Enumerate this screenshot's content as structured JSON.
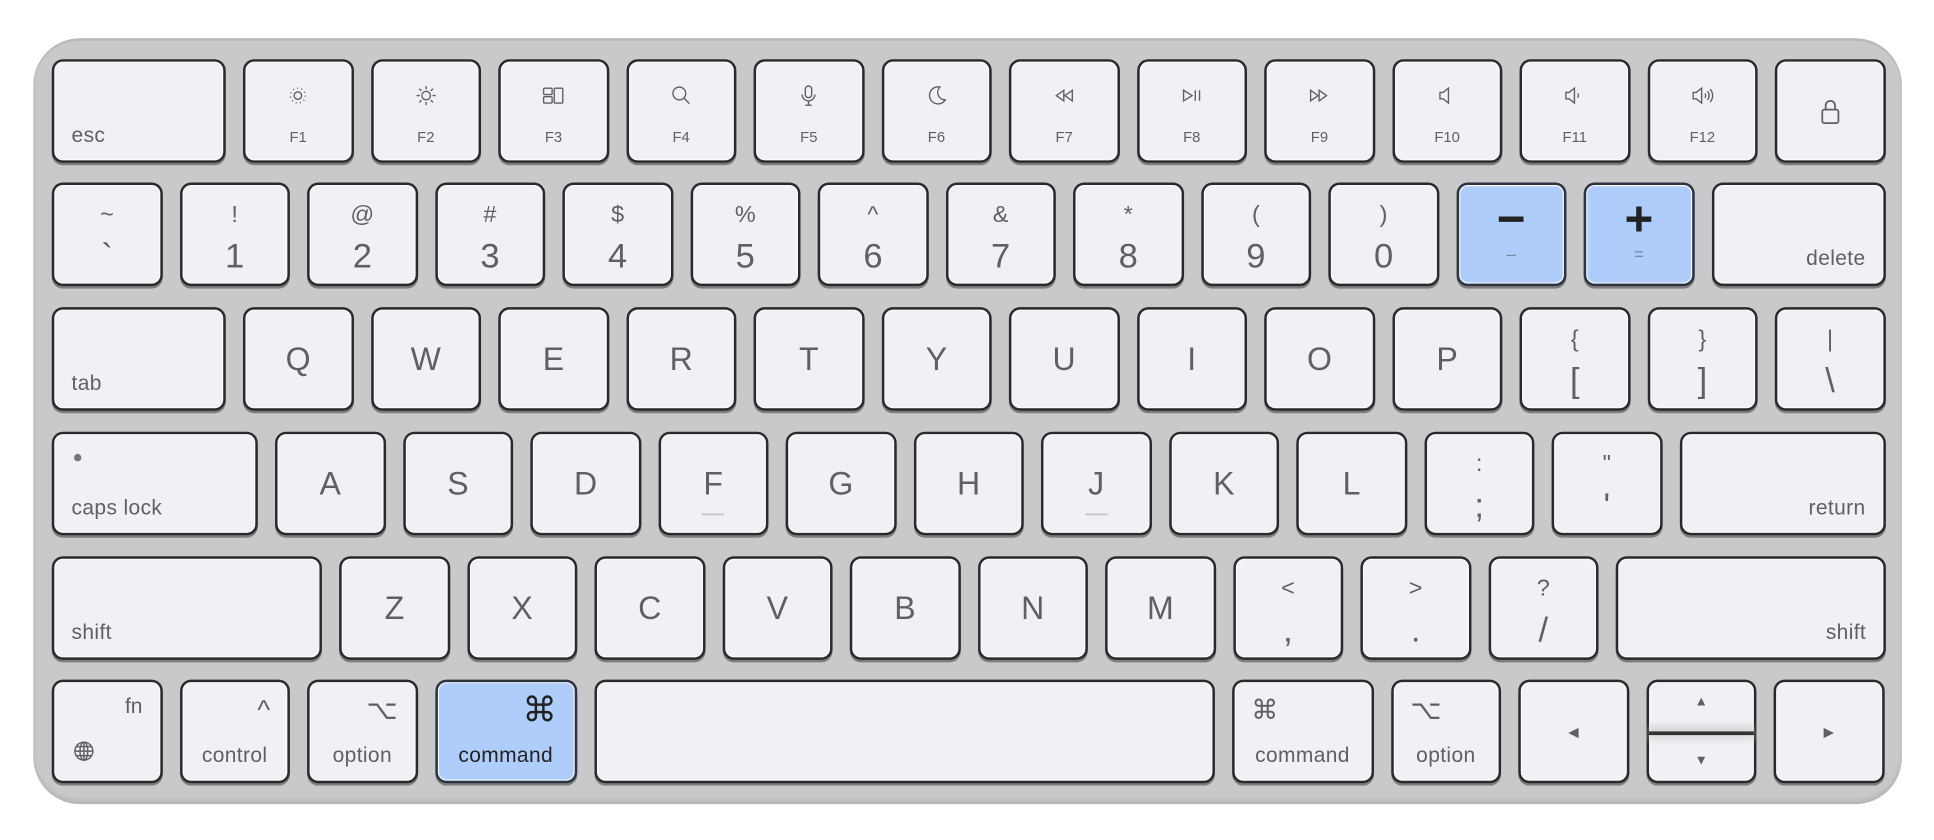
{
  "accent_color": "#aecdfa",
  "rows": [
    [
      {
        "type": "mod",
        "label": "esc",
        "align": "left"
      },
      {
        "type": "fkey",
        "label": "F1",
        "icon": "brightness-down-icon"
      },
      {
        "type": "fkey",
        "label": "F2",
        "icon": "brightness-up-icon"
      },
      {
        "type": "fkey",
        "label": "F3",
        "icon": "mission-control-icon"
      },
      {
        "type": "fkey",
        "label": "F4",
        "icon": "search-icon"
      },
      {
        "type": "fkey",
        "label": "F5",
        "icon": "microphone-icon"
      },
      {
        "type": "fkey",
        "label": "F6",
        "icon": "moon-icon"
      },
      {
        "type": "fkey",
        "label": "F7",
        "icon": "rewind-icon"
      },
      {
        "type": "fkey",
        "label": "F8",
        "icon": "play-pause-icon"
      },
      {
        "type": "fkey",
        "label": "F9",
        "icon": "fast-forward-icon"
      },
      {
        "type": "fkey",
        "label": "F10",
        "icon": "volume-mute-icon"
      },
      {
        "type": "fkey",
        "label": "F11",
        "icon": "volume-down-icon"
      },
      {
        "type": "fkey",
        "label": "F12",
        "icon": "volume-up-icon"
      },
      {
        "type": "iconkey",
        "icon": "lock-icon"
      }
    ],
    [
      {
        "type": "dual",
        "top": "~",
        "bottom": "`"
      },
      {
        "type": "dual",
        "top": "!",
        "bottom": "1"
      },
      {
        "type": "dual",
        "top": "@",
        "bottom": "2"
      },
      {
        "type": "dual",
        "top": "#",
        "bottom": "3"
      },
      {
        "type": "dual",
        "top": "$",
        "bottom": "4"
      },
      {
        "type": "dual",
        "top": "%",
        "bottom": "5"
      },
      {
        "type": "dual",
        "top": "^",
        "bottom": "6"
      },
      {
        "type": "dual",
        "top": "&",
        "bottom": "7"
      },
      {
        "type": "dual",
        "top": "*",
        "bottom": "8"
      },
      {
        "type": "dual",
        "top": "(",
        "bottom": "9"
      },
      {
        "type": "dual",
        "top": ")",
        "bottom": "0"
      },
      {
        "type": "hlsym",
        "top": "−",
        "bottom": "–",
        "highlighted": true
      },
      {
        "type": "hlsym",
        "top": "+",
        "bottom": "=",
        "highlighted": true
      },
      {
        "type": "mod",
        "label": "delete",
        "align": "right"
      }
    ],
    [
      {
        "type": "mod",
        "label": "tab",
        "align": "left"
      },
      {
        "type": "letter",
        "label": "Q"
      },
      {
        "type": "letter",
        "label": "W"
      },
      {
        "type": "letter",
        "label": "E"
      },
      {
        "type": "letter",
        "label": "R"
      },
      {
        "type": "letter",
        "label": "T"
      },
      {
        "type": "letter",
        "label": "Y"
      },
      {
        "type": "letter",
        "label": "U"
      },
      {
        "type": "letter",
        "label": "I"
      },
      {
        "type": "letter",
        "label": "O"
      },
      {
        "type": "letter",
        "label": "P"
      },
      {
        "type": "dual",
        "top": "{",
        "bottom": "["
      },
      {
        "type": "dual",
        "top": "}",
        "bottom": "]"
      },
      {
        "type": "dual",
        "top": "|",
        "bottom": "\\"
      }
    ],
    [
      {
        "type": "mod",
        "label": "caps lock",
        "align": "left",
        "indicator": true
      },
      {
        "type": "letter",
        "label": "A"
      },
      {
        "type": "letter",
        "label": "S"
      },
      {
        "type": "letter",
        "label": "D"
      },
      {
        "type": "letter",
        "label": "F",
        "bump": true
      },
      {
        "type": "letter",
        "label": "G"
      },
      {
        "type": "letter",
        "label": "H"
      },
      {
        "type": "letter",
        "label": "J",
        "bump": true
      },
      {
        "type": "letter",
        "label": "K"
      },
      {
        "type": "letter",
        "label": "L"
      },
      {
        "type": "dual",
        "top": ":",
        "bottom": ";"
      },
      {
        "type": "dual",
        "top": "\"",
        "bottom": "'"
      },
      {
        "type": "mod",
        "label": "return",
        "align": "right"
      }
    ],
    [
      {
        "type": "mod",
        "label": "shift",
        "align": "left"
      },
      {
        "type": "letter",
        "label": "Z"
      },
      {
        "type": "letter",
        "label": "X"
      },
      {
        "type": "letter",
        "label": "C"
      },
      {
        "type": "letter",
        "label": "V"
      },
      {
        "type": "letter",
        "label": "B"
      },
      {
        "type": "letter",
        "label": "N"
      },
      {
        "type": "letter",
        "label": "M"
      },
      {
        "type": "dual",
        "top": "<",
        "bottom": ","
      },
      {
        "type": "dual",
        "top": ">",
        "bottom": "."
      },
      {
        "type": "dual",
        "top": "?",
        "bottom": "/"
      },
      {
        "type": "mod",
        "label": "shift",
        "align": "right"
      }
    ],
    [
      {
        "type": "fn",
        "label": "fn",
        "icon": "globe-icon"
      },
      {
        "type": "modsym",
        "label": "control",
        "symbol": "^",
        "symbol_side": "right"
      },
      {
        "type": "modsym",
        "label": "option",
        "symbol": "⌥",
        "symbol_side": "right"
      },
      {
        "type": "modsym",
        "label": "command",
        "symbol": "⌘",
        "symbol_side": "right",
        "highlighted": true
      },
      {
        "type": "space"
      },
      {
        "type": "modsym",
        "label": "command",
        "symbol": "⌘",
        "symbol_side": "left"
      },
      {
        "type": "modsym",
        "label": "option",
        "symbol": "⌥",
        "symbol_side": "left"
      },
      {
        "type": "arrow",
        "symbol": "◀",
        "name": "left"
      },
      {
        "type": "updown",
        "up": "▲",
        "down": "▼"
      },
      {
        "type": "arrow",
        "symbol": "▶",
        "name": "right"
      }
    ]
  ]
}
